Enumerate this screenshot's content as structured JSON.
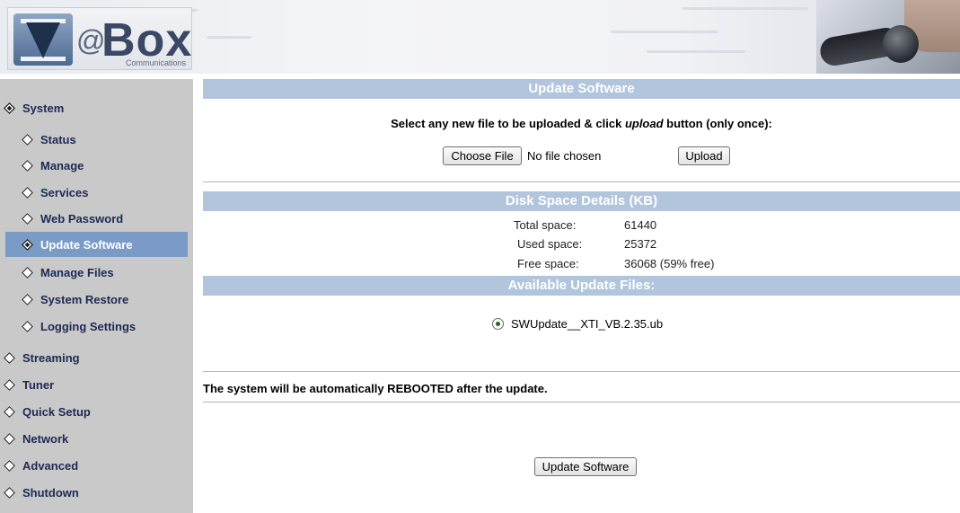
{
  "header": {
    "logo_at": "@",
    "logo_brand": "Box",
    "logo_subtitle": "Communications"
  },
  "sidebar": {
    "items": [
      {
        "label": "System",
        "filled": true
      },
      {
        "label": "Status",
        "filled": false
      },
      {
        "label": "Manage",
        "filled": false
      },
      {
        "label": "Services",
        "filled": false
      },
      {
        "label": "Web Password",
        "filled": false
      },
      {
        "label": "Update Software",
        "filled": true,
        "selected": true
      },
      {
        "label": "Manage Files",
        "filled": false
      },
      {
        "label": "System Restore",
        "filled": false
      },
      {
        "label": "Logging Settings",
        "filled": false
      },
      {
        "label": "Streaming",
        "filled": false
      },
      {
        "label": "Tuner",
        "filled": false
      },
      {
        "label": "Quick Setup",
        "filled": false
      },
      {
        "label": "Network",
        "filled": false
      },
      {
        "label": "Advanced",
        "filled": false
      },
      {
        "label": "Shutdown",
        "filled": false
      }
    ]
  },
  "update": {
    "title": "Update Software",
    "instruction_pre": "Select any new file to be uploaded & click ",
    "instruction_em": "upload",
    "instruction_post": " button (only once):",
    "choose_file_label": "Choose File",
    "no_file_text": "No file chosen",
    "upload_label": "Upload"
  },
  "disk": {
    "title": "Disk Space Details (KB)",
    "total_label": "Total space:",
    "total_value": "61440",
    "used_label": "Used space:",
    "used_value": "25372",
    "free_label": "Free space:",
    "free_value": "36068 (59% free)"
  },
  "available": {
    "title": "Available Update Files:",
    "file_name": "SWUpdate__XTI_VB.2.35.ub",
    "selected": true
  },
  "reboot_notice": "The system will be automatically REBOOTED after the update.",
  "update_button_label": "Update Software",
  "colors": {
    "section_bar": "#b1c5dd",
    "sidebar_bg": "#c9c9c9",
    "selected_item": "#7a9bc6",
    "nav_text": "#1b2a55"
  }
}
